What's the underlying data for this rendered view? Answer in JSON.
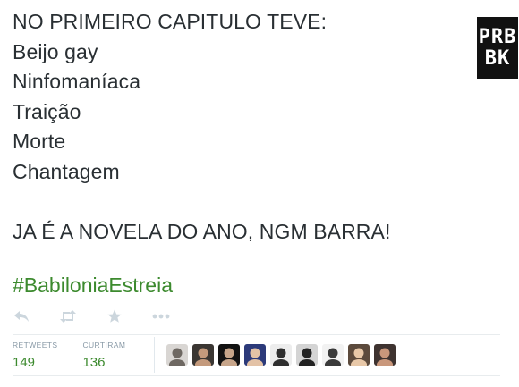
{
  "tweet": {
    "lines": [
      "NO PRIMEIRO CAPITULO TEVE:",
      "Beijo gay",
      "Ninfomaníaca",
      "Traição",
      "Morte",
      "Chantagem",
      "",
      "JA É A NOVELA DO ANO, NGM BARRA!"
    ],
    "hashtag": "#BabiloniaEstreia"
  },
  "logo": {
    "row1": "PRB",
    "row2": "BK",
    "background": "#111111"
  },
  "actions": [
    {
      "icon": "reply-icon"
    },
    {
      "icon": "retweet-icon"
    },
    {
      "icon": "favorite-star-icon"
    },
    {
      "icon": "more-options-icon"
    }
  ],
  "stats": {
    "retweets_label": "RETWEETS",
    "retweets_value": "149",
    "likes_label": "CURTIRAM",
    "likes_value": "136"
  },
  "avatars": [
    {
      "bg": "#d9d6d3",
      "fg": "#6e6862"
    },
    {
      "bg": "#3a3632",
      "fg": "#c49a7c"
    },
    {
      "bg": "#121212",
      "fg": "#c7a58a"
    },
    {
      "bg": "#2c3a7a",
      "fg": "#e3c2a6"
    },
    {
      "bg": "#ededed",
      "fg": "#2f2f2f"
    },
    {
      "bg": "#d4d4d4",
      "fg": "#232323"
    },
    {
      "bg": "#f2f2f2",
      "fg": "#3a3a3a"
    },
    {
      "bg": "#5c4a3c",
      "fg": "#e8c8a8"
    },
    {
      "bg": "#3e3330",
      "fg": "#c9977b"
    }
  ],
  "colors": {
    "text": "#292f33",
    "hashtag": "#3c8a2e",
    "stat_value": "#3c8a2e",
    "muted": "#8899a6",
    "icon": "#ccd6dd"
  }
}
